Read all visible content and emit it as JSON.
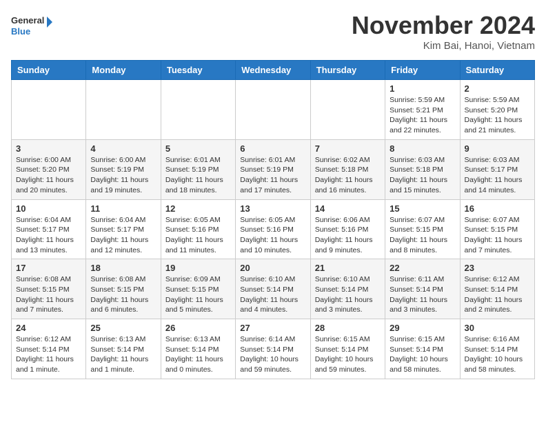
{
  "header": {
    "logo_line1": "General",
    "logo_line2": "Blue",
    "month": "November 2024",
    "location": "Kim Bai, Hanoi, Vietnam"
  },
  "days_of_week": [
    "Sunday",
    "Monday",
    "Tuesday",
    "Wednesday",
    "Thursday",
    "Friday",
    "Saturday"
  ],
  "weeks": [
    [
      {
        "day": "",
        "info": ""
      },
      {
        "day": "",
        "info": ""
      },
      {
        "day": "",
        "info": ""
      },
      {
        "day": "",
        "info": ""
      },
      {
        "day": "",
        "info": ""
      },
      {
        "day": "1",
        "info": "Sunrise: 5:59 AM\nSunset: 5:21 PM\nDaylight: 11 hours and 22 minutes."
      },
      {
        "day": "2",
        "info": "Sunrise: 5:59 AM\nSunset: 5:20 PM\nDaylight: 11 hours and 21 minutes."
      }
    ],
    [
      {
        "day": "3",
        "info": "Sunrise: 6:00 AM\nSunset: 5:20 PM\nDaylight: 11 hours and 20 minutes."
      },
      {
        "day": "4",
        "info": "Sunrise: 6:00 AM\nSunset: 5:19 PM\nDaylight: 11 hours and 19 minutes."
      },
      {
        "day": "5",
        "info": "Sunrise: 6:01 AM\nSunset: 5:19 PM\nDaylight: 11 hours and 18 minutes."
      },
      {
        "day": "6",
        "info": "Sunrise: 6:01 AM\nSunset: 5:19 PM\nDaylight: 11 hours and 17 minutes."
      },
      {
        "day": "7",
        "info": "Sunrise: 6:02 AM\nSunset: 5:18 PM\nDaylight: 11 hours and 16 minutes."
      },
      {
        "day": "8",
        "info": "Sunrise: 6:03 AM\nSunset: 5:18 PM\nDaylight: 11 hours and 15 minutes."
      },
      {
        "day": "9",
        "info": "Sunrise: 6:03 AM\nSunset: 5:17 PM\nDaylight: 11 hours and 14 minutes."
      }
    ],
    [
      {
        "day": "10",
        "info": "Sunrise: 6:04 AM\nSunset: 5:17 PM\nDaylight: 11 hours and 13 minutes."
      },
      {
        "day": "11",
        "info": "Sunrise: 6:04 AM\nSunset: 5:17 PM\nDaylight: 11 hours and 12 minutes."
      },
      {
        "day": "12",
        "info": "Sunrise: 6:05 AM\nSunset: 5:16 PM\nDaylight: 11 hours and 11 minutes."
      },
      {
        "day": "13",
        "info": "Sunrise: 6:05 AM\nSunset: 5:16 PM\nDaylight: 11 hours and 10 minutes."
      },
      {
        "day": "14",
        "info": "Sunrise: 6:06 AM\nSunset: 5:16 PM\nDaylight: 11 hours and 9 minutes."
      },
      {
        "day": "15",
        "info": "Sunrise: 6:07 AM\nSunset: 5:15 PM\nDaylight: 11 hours and 8 minutes."
      },
      {
        "day": "16",
        "info": "Sunrise: 6:07 AM\nSunset: 5:15 PM\nDaylight: 11 hours and 7 minutes."
      }
    ],
    [
      {
        "day": "17",
        "info": "Sunrise: 6:08 AM\nSunset: 5:15 PM\nDaylight: 11 hours and 7 minutes."
      },
      {
        "day": "18",
        "info": "Sunrise: 6:08 AM\nSunset: 5:15 PM\nDaylight: 11 hours and 6 minutes."
      },
      {
        "day": "19",
        "info": "Sunrise: 6:09 AM\nSunset: 5:15 PM\nDaylight: 11 hours and 5 minutes."
      },
      {
        "day": "20",
        "info": "Sunrise: 6:10 AM\nSunset: 5:14 PM\nDaylight: 11 hours and 4 minutes."
      },
      {
        "day": "21",
        "info": "Sunrise: 6:10 AM\nSunset: 5:14 PM\nDaylight: 11 hours and 3 minutes."
      },
      {
        "day": "22",
        "info": "Sunrise: 6:11 AM\nSunset: 5:14 PM\nDaylight: 11 hours and 3 minutes."
      },
      {
        "day": "23",
        "info": "Sunrise: 6:12 AM\nSunset: 5:14 PM\nDaylight: 11 hours and 2 minutes."
      }
    ],
    [
      {
        "day": "24",
        "info": "Sunrise: 6:12 AM\nSunset: 5:14 PM\nDaylight: 11 hours and 1 minute."
      },
      {
        "day": "25",
        "info": "Sunrise: 6:13 AM\nSunset: 5:14 PM\nDaylight: 11 hours and 1 minute."
      },
      {
        "day": "26",
        "info": "Sunrise: 6:13 AM\nSunset: 5:14 PM\nDaylight: 11 hours and 0 minutes."
      },
      {
        "day": "27",
        "info": "Sunrise: 6:14 AM\nSunset: 5:14 PM\nDaylight: 10 hours and 59 minutes."
      },
      {
        "day": "28",
        "info": "Sunrise: 6:15 AM\nSunset: 5:14 PM\nDaylight: 10 hours and 59 minutes."
      },
      {
        "day": "29",
        "info": "Sunrise: 6:15 AM\nSunset: 5:14 PM\nDaylight: 10 hours and 58 minutes."
      },
      {
        "day": "30",
        "info": "Sunrise: 6:16 AM\nSunset: 5:14 PM\nDaylight: 10 hours and 58 minutes."
      }
    ]
  ]
}
